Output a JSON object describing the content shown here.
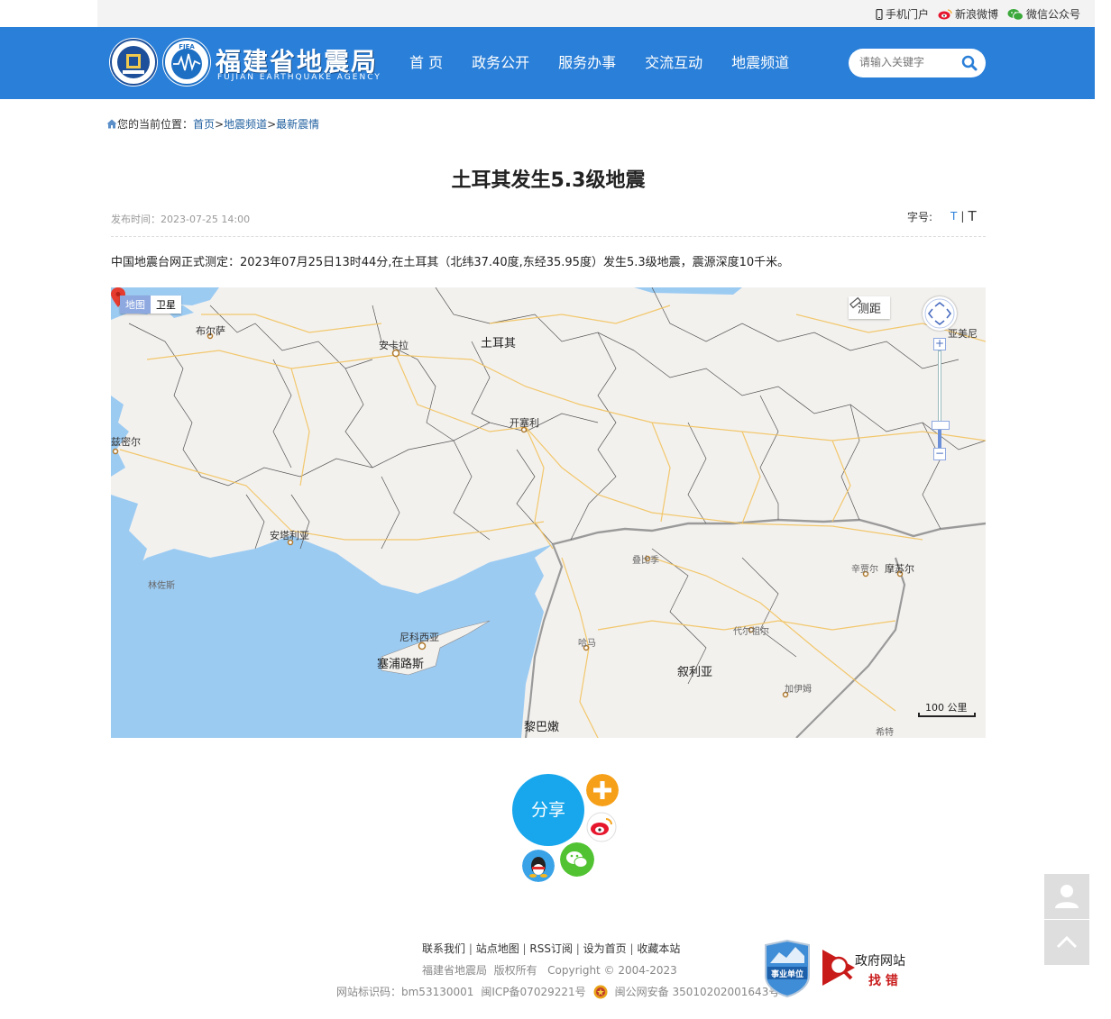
{
  "topbar": {
    "mobile": "手机门户",
    "weibo": "新浪微博",
    "wechat": "微信公众号"
  },
  "header": {
    "logo_cn": "福建省地震局",
    "logo_en": "FUJIAN EARTHQUAKE AGENCY",
    "nav": [
      "首 页",
      "政务公开",
      "服务办事",
      "交流互动",
      "地震频道"
    ],
    "search_placeholder": "请输入关键字"
  },
  "breadcrumb": {
    "prefix": "您的当前位置：",
    "items": [
      "首页",
      "地震频道",
      "最新震情"
    ],
    "sep": ">"
  },
  "article": {
    "title": "土耳其发生5.3级地震",
    "publish": "发布时间：2023-07-25 14:00",
    "font_label": "字号:",
    "font_small": "T",
    "font_sep": "|",
    "font_large": "T",
    "body": "中国地震台网正式测定：2023年07月25日13时44分,在土耳其（北纬37.40度,东经35.95度）发生5.3级地震，震源深度10千米。"
  },
  "map": {
    "type_map": "地图",
    "type_sat": "卫星",
    "measure": "测距",
    "scale": "100 公里",
    "labels": {
      "bursa": "布尔萨",
      "ankara": "安卡拉",
      "turkey": "土耳其",
      "armenia": "亚美尼",
      "izmir": "兹密尔",
      "kayseri": "开塞利",
      "antalya": "安塔利亚",
      "aleppo": "叠比季",
      "raqqa": "辛贾尔",
      "mosul": "摩苏尔",
      "limassol": "林佐斯",
      "nicosia": "尼科西亚",
      "cyprus": "塞浦路斯",
      "hama": "哈马",
      "deir": "代尔祖尔",
      "syria": "叙利亚",
      "abukamal": "加伊姆",
      "lebanon": "黎巴嫩",
      "hit": "希特"
    },
    "colors": {
      "land": "#f3f1ee",
      "sea": "#9ccbf2",
      "border": "#5a5a5a",
      "road": "#f5c96a"
    }
  },
  "share": {
    "label": "分享"
  },
  "footer": {
    "links": [
      "联系我们",
      "站点地图",
      "RSS订阅",
      "设为首页",
      "收藏本站"
    ],
    "copyright_org": "福建省地震局",
    "copyright_rights": "版权所有",
    "copyright_years": "Copyright © 2004-2023",
    "site_id": "网站标识码：bm53130001",
    "icp": "闽ICP备07029221号",
    "police": "闽公网安备 35010202001643号",
    "badge": "事业单位",
    "gov_find_1": "政府网站",
    "gov_find_2": "找 错"
  }
}
